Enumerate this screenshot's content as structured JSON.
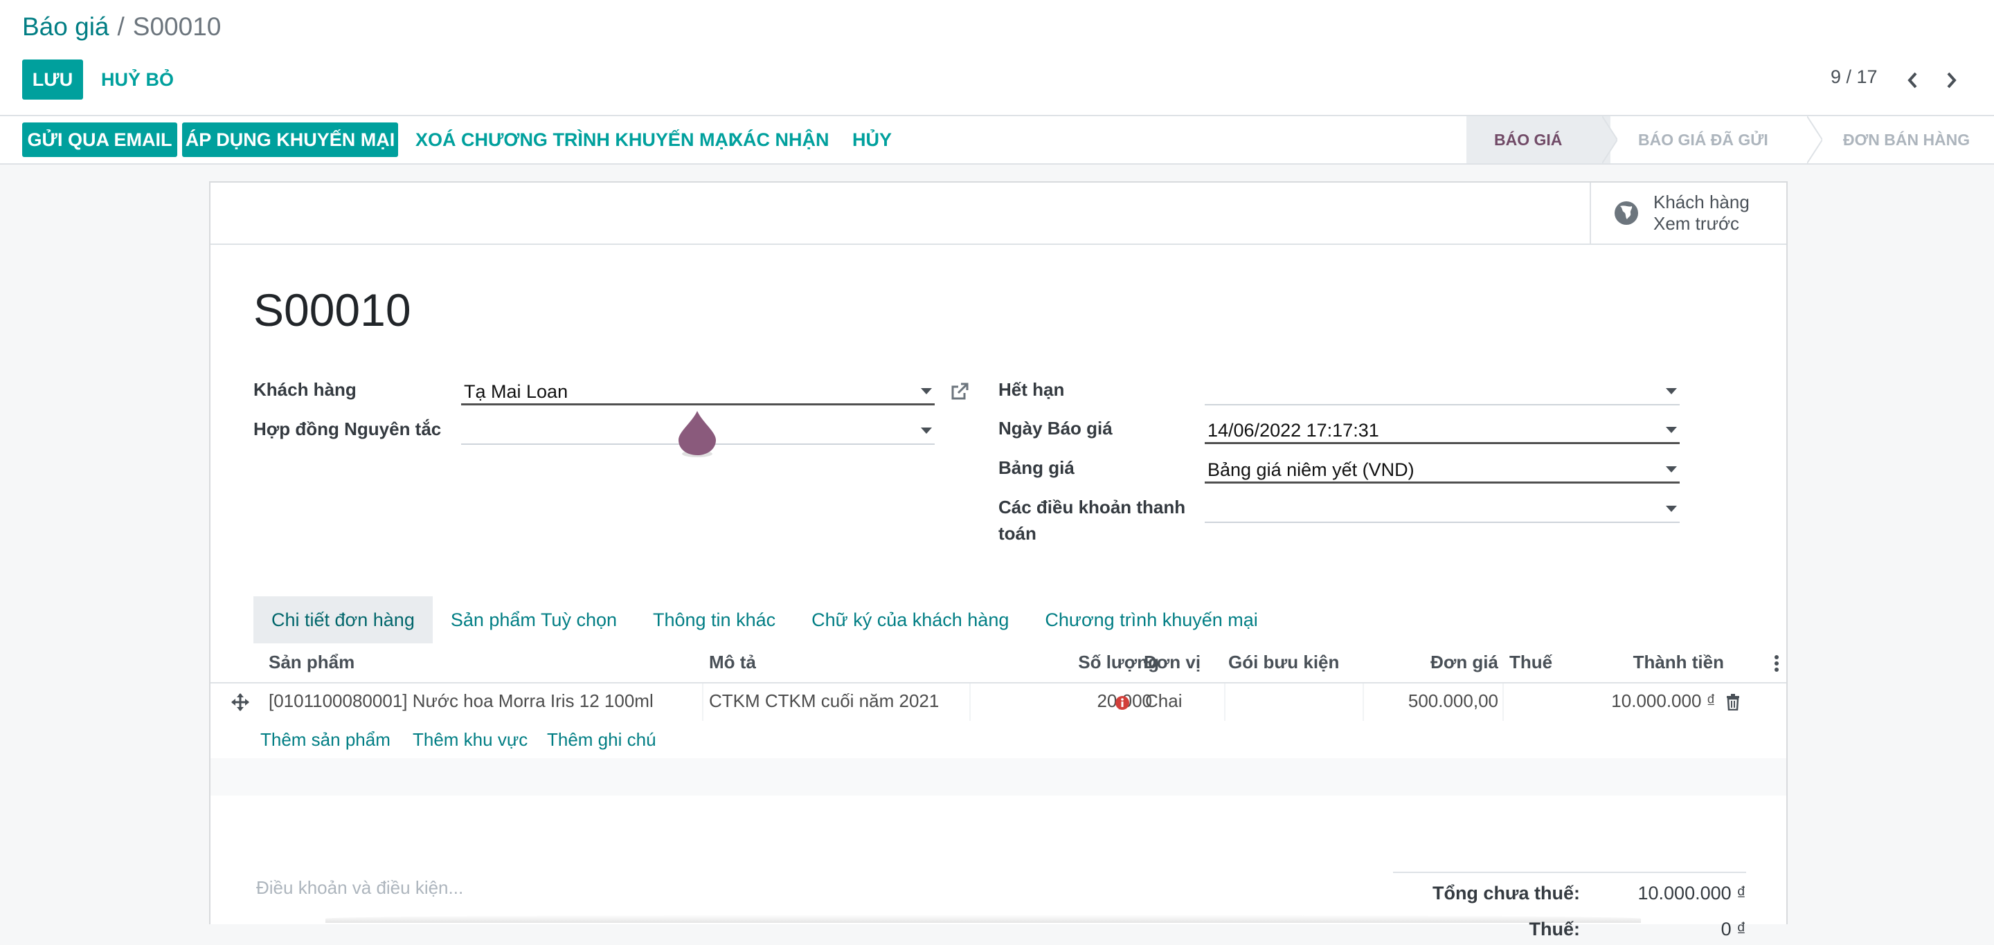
{
  "breadcrumb": {
    "parent": "Báo giá",
    "separator": "/",
    "current": "S00010"
  },
  "actions": {
    "save": "LƯU",
    "discard": "HUỶ BỎ"
  },
  "pager": {
    "value": "9 / 17"
  },
  "header_buttons": {
    "send_email": "GỬI QUA EMAIL",
    "apply_promo": "ÁP DỤNG KHUYẾN MẠI",
    "remove_promo": "XOÁ CHƯƠNG TRÌNH KHUYẾN MẠI",
    "confirm": "XÁC NHẬN",
    "cancel": "HỦY"
  },
  "status_steps": [
    "BÁO GIÁ",
    "BÁO GIÁ ĐÃ GỬI",
    "ĐƠN BÁN HÀNG"
  ],
  "status_active": "BÁO GIÁ",
  "smart_button": {
    "line1": "Khách hàng",
    "line2": "Xem trước",
    "icon": "globe-icon"
  },
  "record": {
    "name": "S00010"
  },
  "fields": {
    "customer": {
      "label": "Khách hàng",
      "value": "Tạ Mai Loan"
    },
    "contract": {
      "label": "Hợp đồng Nguyên tắc",
      "value": ""
    },
    "expiration": {
      "label": "Hết hạn",
      "value": ""
    },
    "quote_date": {
      "label": "Ngày Báo giá",
      "value": "14/06/2022 17:17:31"
    },
    "pricelist": {
      "label": "Bảng giá",
      "value": "Bảng giá niêm yết (VND)"
    },
    "payment_terms": {
      "label_line1": "Các điều khoản thanh",
      "label_line2": "toán",
      "value": ""
    }
  },
  "tabs": [
    "Chi tiết đơn hàng",
    "Sản phẩm Tuỳ chọn",
    "Thông tin khác",
    "Chữ ký của khách hàng",
    "Chương trình khuyến mại"
  ],
  "active_tab": "Chi tiết đơn hàng",
  "order_lines": {
    "columns": {
      "product": "Sản phẩm",
      "description": "Mô tả",
      "quantity": "Số lượng",
      "uom": "Đơn vị",
      "package": "Gói bưu kiện",
      "price_unit": "Đơn giá",
      "tax": "Thuế",
      "subtotal": "Thành tiền"
    },
    "rows": [
      {
        "product": "[0101100080001] Nước hoa Morra Iris 12 100ml",
        "description": "CTKM CTKM cuối năm 2021",
        "quantity": "20,000",
        "uom": "Chai",
        "package": "",
        "price_unit": "500.000,00",
        "tax": "",
        "subtotal": "10.000.000 ₫"
      }
    ],
    "add_product": "Thêm sản phẩm",
    "add_section": "Thêm khu vực",
    "add_note": "Thêm ghi chú"
  },
  "terms_placeholder": "Điều khoản và điều kiện...",
  "totals": {
    "untaxed_label": "Tổng chưa thuế:",
    "untaxed_value": "10.000.000 ₫",
    "tax_label": "Thuế:",
    "tax_value": "0 ₫"
  },
  "colors": {
    "primary": "#00a09d",
    "link": "#017e84",
    "active_status": "#714b67",
    "drop_cursor": "#8a5a7c"
  }
}
